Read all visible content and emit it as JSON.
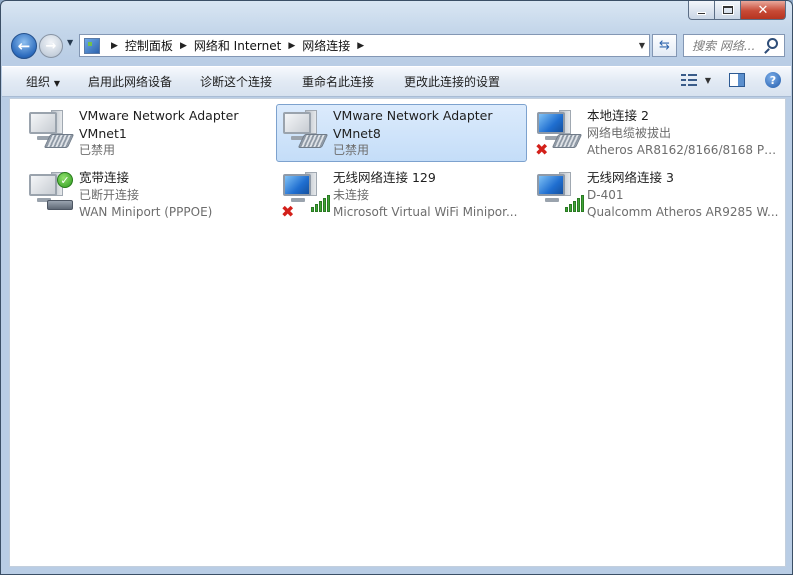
{
  "address": {
    "crumbs": [
      "控制面板",
      "网络和 Internet",
      "网络连接"
    ],
    "search_placeholder": "搜索 网络..."
  },
  "toolbar": {
    "organize": "组织",
    "enable": "启用此网络设备",
    "diagnose": "诊断这个连接",
    "rename": "重命名此连接",
    "change_settings": "更改此连接的设置"
  },
  "connections": [
    {
      "name": "VMware Network Adapter",
      "line2": "VMnet1",
      "line3": "已禁用",
      "icon": "wired-disabled-icon",
      "selected": false
    },
    {
      "name": "VMware Network Adapter",
      "line2": "VMnet8",
      "line3": "已禁用",
      "icon": "wired-disabled-icon",
      "selected": true
    },
    {
      "name": "本地连接 2",
      "line2": "网络电缆被拔出",
      "line3": "Atheros AR8162/8166/8168 PC...",
      "icon": "wired-unplugged-icon",
      "selected": false
    },
    {
      "name": "宽带连接",
      "line2": "已断开连接",
      "line3": "WAN Miniport (PPPOE)",
      "icon": "broadband-icon",
      "selected": false
    },
    {
      "name": "无线网络连接 129",
      "line2": "未连接",
      "line3": "Microsoft Virtual WiFi Minipor...",
      "icon": "wireless-disconnected-icon",
      "selected": false
    },
    {
      "name": "无线网络连接 3",
      "line2": "D-401",
      "line3": "Qualcomm Atheros AR9285 W...",
      "icon": "wireless-connected-icon",
      "selected": false
    }
  ],
  "colors": {
    "selection_bg": "#cfe3fa",
    "selection_border": "#7da2ce",
    "status_gray": "#6d6d6d",
    "signal_green": "#3fa535",
    "error_red": "#d3201a"
  }
}
